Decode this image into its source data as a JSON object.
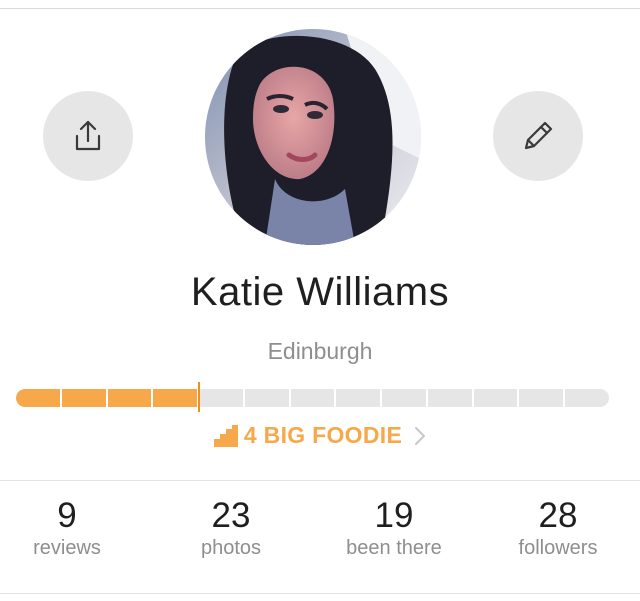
{
  "profile": {
    "name": "Katie Williams",
    "location": "Edinburgh"
  },
  "actions": {
    "share_icon": "share-upload-icon",
    "edit_icon": "pencil-icon"
  },
  "level": {
    "label": "4 BIG FOODIE",
    "progress_fraction": 0.31,
    "segments": 13,
    "accent_color": "#f7a84a"
  },
  "stats": [
    {
      "value": "9",
      "label": "reviews"
    },
    {
      "value": "23",
      "label": "photos"
    },
    {
      "value": "19",
      "label": "been there"
    },
    {
      "value": "28",
      "label": "followers"
    }
  ]
}
